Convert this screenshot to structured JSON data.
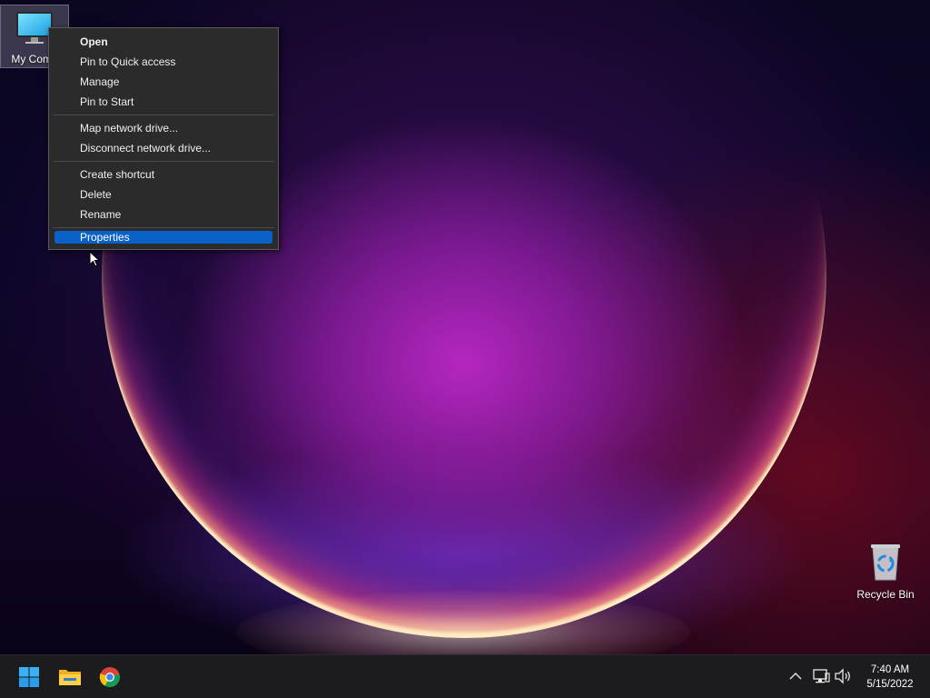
{
  "desktop": {
    "icons": {
      "computer": {
        "label": "My Comp",
        "icon": "computer-icon"
      },
      "recycle_bin": {
        "label": "Recycle Bin",
        "icon": "recycle-bin-icon"
      }
    }
  },
  "context_menu": {
    "groups": [
      [
        "Open",
        "Pin to Quick access",
        "Manage",
        "Pin to Start"
      ],
      [
        "Map network drive...",
        "Disconnect network drive..."
      ],
      [
        "Create shortcut",
        "Delete",
        "Rename"
      ],
      [
        "Properties"
      ]
    ],
    "default_item": "Open",
    "highlighted_item": "Properties"
  },
  "taskbar": {
    "pinned": [
      {
        "name": "Start",
        "icon": "windows-start-icon"
      },
      {
        "name": "File Explorer",
        "icon": "folder-icon"
      },
      {
        "name": "Google Chrome",
        "icon": "chrome-icon"
      }
    ],
    "tray": {
      "icons": [
        "chevron-up-icon",
        "network-icon",
        "volume-icon"
      ]
    },
    "clock": {
      "time": "7:40 AM",
      "date": "5/15/2022"
    }
  },
  "colors": {
    "highlight": "#0a62c9",
    "menu_bg": "#2b2b2b",
    "taskbar_bg": "#1c1c1e"
  }
}
